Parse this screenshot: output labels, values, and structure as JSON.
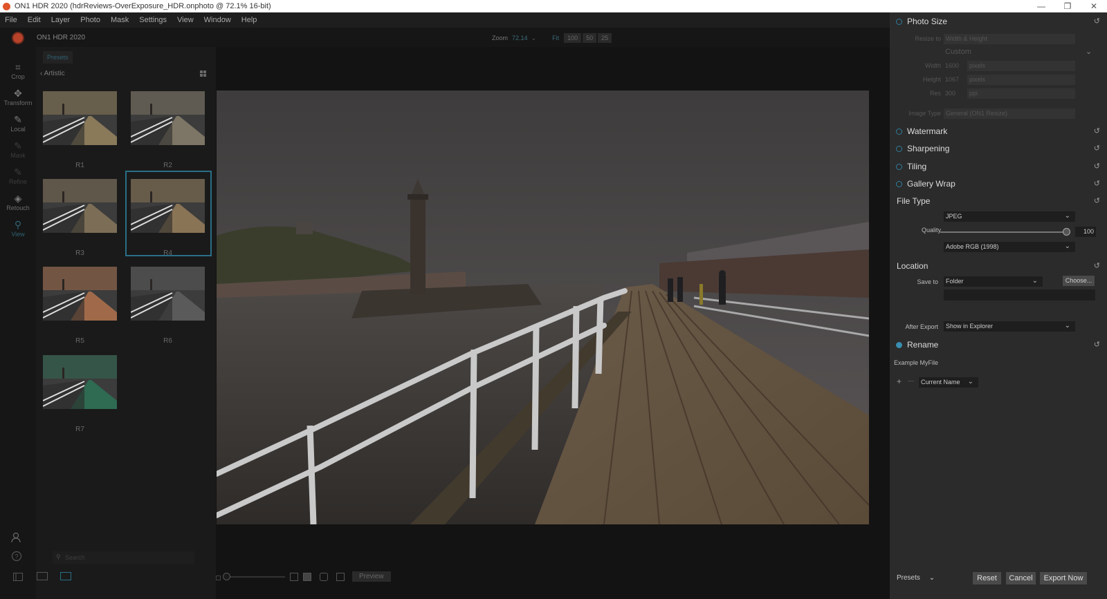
{
  "window": {
    "title": "ON1 HDR 2020 (hdrReviews-OverExposure_HDR.onphoto @ 72.1% 16-bit)",
    "minimize": "—",
    "restore": "❐",
    "close": "✕"
  },
  "menu": [
    "File",
    "Edit",
    "Layer",
    "Photo",
    "Mask",
    "Settings",
    "View",
    "Window",
    "Help"
  ],
  "header": {
    "app_name": "ON1 HDR 2020",
    "zoom_label": "Zoom",
    "zoom_value": "72.14",
    "zoom_caret": "⌄",
    "zoom_buttons": [
      "Fit",
      "100",
      "50",
      "25"
    ]
  },
  "tools": [
    {
      "label": "Crop",
      "icon": "crop-icon",
      "glyph": "⌗",
      "state": "normal"
    },
    {
      "label": "Transform",
      "icon": "move-icon",
      "glyph": "✥",
      "state": "normal"
    },
    {
      "label": "Local",
      "icon": "brush-icon",
      "glyph": "✎",
      "state": "normal"
    },
    {
      "label": "Mask",
      "icon": "mask-brush-icon",
      "glyph": "✎",
      "state": "dim"
    },
    {
      "label": "Refine",
      "icon": "refine-brush-icon",
      "glyph": "✎",
      "state": "dim"
    },
    {
      "label": "Retouch",
      "icon": "retouch-icon",
      "glyph": "◈",
      "state": "normal"
    },
    {
      "label": "View",
      "icon": "view-zoom-icon",
      "glyph": "⚲",
      "state": "active"
    }
  ],
  "presets": {
    "tab": "Presets",
    "back_glyph": "‹",
    "category": "Artistic",
    "search_placeholder": "Search",
    "items": [
      {
        "label": "R1",
        "tint": "#8a7a5a"
      },
      {
        "label": "R2",
        "tint": "#7d7565"
      },
      {
        "label": "R3",
        "tint": "#7c6e56"
      },
      {
        "label": "R4",
        "tint": "#8a7456"
      },
      {
        "label": "R5",
        "tint": "#a06a4a"
      },
      {
        "label": "R6",
        "tint": "#5a5a5a"
      },
      {
        "label": "R7",
        "tint": "#2f6a52"
      }
    ]
  },
  "bottom_bar": {
    "preview": "Preview"
  },
  "right_panel": {
    "photo_size": {
      "title": "Photo Size",
      "resize_to_label": "Resize to",
      "resize_to_value": "Width & Height",
      "preset": "Custom",
      "width_label": "Width",
      "width_value": "1600",
      "width_unit": "pixels",
      "height_label": "Height",
      "height_value": "1067",
      "height_unit": "pixels",
      "res_label": "Res",
      "res_value": "300",
      "res_unit": "ppi",
      "image_type_label": "Image Type",
      "image_type_value": "General (ON1 Resize)"
    },
    "watermark": "Watermark",
    "sharpening": "Sharpening",
    "tiling": "Tiling",
    "gallery_wrap": "Gallery Wrap",
    "file_type": {
      "title": "File Type",
      "format": "JPEG",
      "quality_label": "Quality",
      "quality_value": "100",
      "quality_fraction": 1.0,
      "color_space": "Adobe RGB (1998)"
    },
    "location": {
      "title": "Location",
      "save_to_label": "Save to",
      "save_to_value": "Folder",
      "choose": "Choose...",
      "after_export_label": "After Export",
      "after_export_value": "Show in Explorer"
    },
    "rename": {
      "title": "Rename",
      "example": "Example MyFile",
      "plus": "+",
      "minus": "—",
      "token": "Current Name"
    },
    "footer": {
      "presets": "Presets",
      "reset": "Reset",
      "cancel": "Cancel",
      "export": "Export Now"
    },
    "reset_glyph": "↺",
    "caret_glyph": "⌄"
  },
  "colors": {
    "accent": "#2e7d9c",
    "panel": "#2b2b2b",
    "selection": "#2a6f86"
  }
}
